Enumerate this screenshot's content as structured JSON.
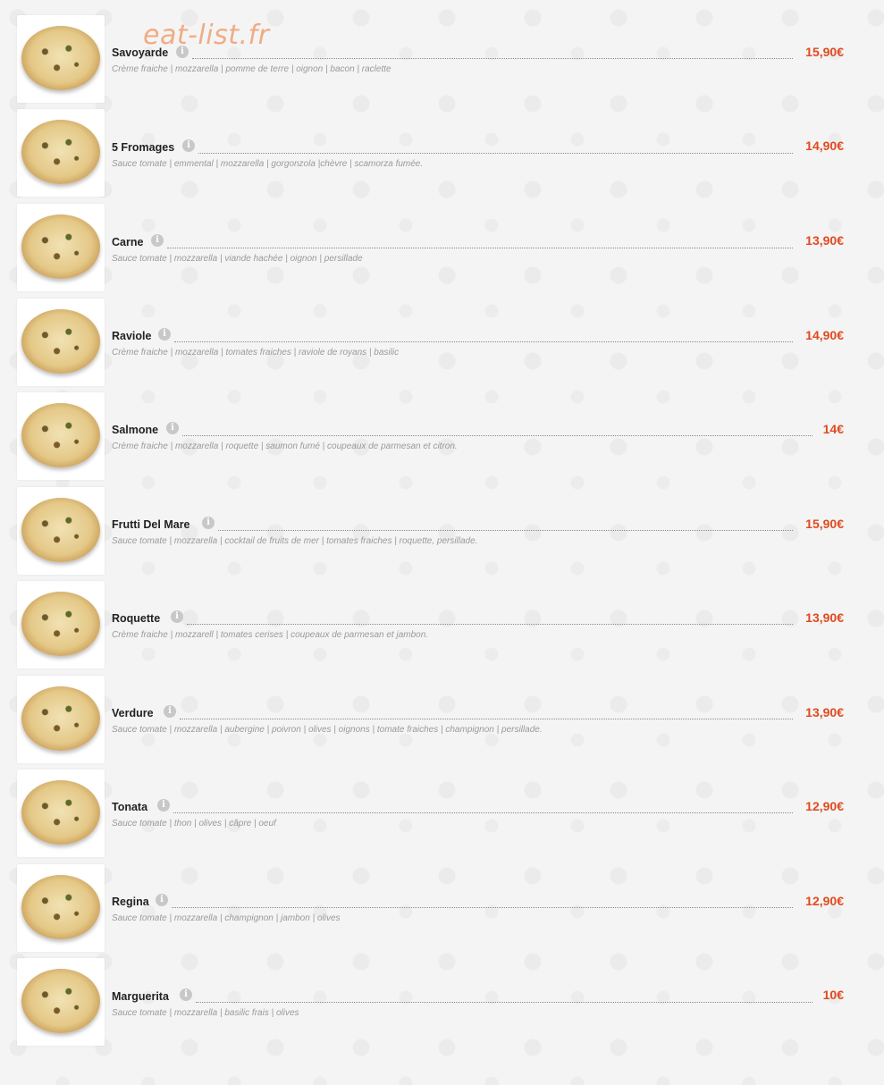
{
  "watermark": "eat-list.fr",
  "accent_color": "#e04a1f",
  "icons": {
    "info": "info-icon",
    "thumbnail": "pizza-image"
  },
  "items": [
    {
      "name": "Savoyarde",
      "price": "15,90€",
      "description": "Crème fraiche | mozzarella | pomme de terre | oignon | bacon | raclette"
    },
    {
      "name": "5 Fromages",
      "price": "14,90€",
      "description": "Sauce tomate | emmental | mozzarella | gorgonzola |chèvre | scamorza fumée."
    },
    {
      "name": "Carne",
      "price": "13,90€",
      "description": "Sauce tomate | mozzarella | viande hachée | oignon | persillade"
    },
    {
      "name": "Raviole",
      "price": "14,90€",
      "description": "Crème fraiche | mozzarella | tomates fraiches | raviole de royans | basilic"
    },
    {
      "name": "Salmone",
      "price": "14€",
      "description": "Crème fraiche | mozzarella | roquette | saumon fumé | coupeaux de parmesan et citron."
    },
    {
      "name": "Frutti Del Mare",
      "price": "15,90€",
      "description": "Sauce tomate | mozzarella | cocktail de fruits de mer | tomates fraiches | roquette, persillade."
    },
    {
      "name": "Roquette",
      "price": "13,90€",
      "description": "Crème fraiche | mozzarell | tomates cerises | coupeaux de parmesan et jambon."
    },
    {
      "name": "Verdure",
      "price": "13,90€",
      "description": "Sauce tomate | mozzarella | aubergine | poivron | olives | oignons | tomate fraiches | champignon | persillade."
    },
    {
      "name": "Tonata",
      "price": "12,90€",
      "description": "Sauce tomate | thon | olives | câpre | oeuf"
    },
    {
      "name": "Regina",
      "price": "12,90€",
      "description": "Sauce tomate | mozzarella | champignon | jambon | olives"
    },
    {
      "name": "Marguerita",
      "price": "10€",
      "description": "Sauce tomate | mozzarella | basilic frais | olives"
    }
  ]
}
